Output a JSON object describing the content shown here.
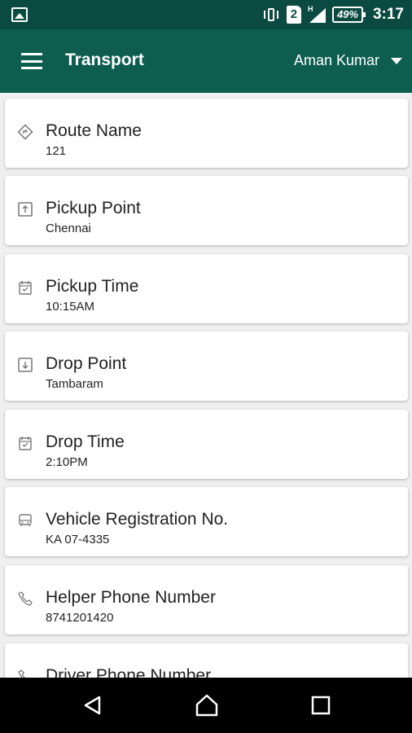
{
  "status_bar": {
    "sim": "2",
    "network": "H",
    "battery": "49%",
    "time": "3:17"
  },
  "app_bar": {
    "title": "Transport",
    "user": "Aman Kumar"
  },
  "items": [
    {
      "label": "Route Name",
      "value": "121",
      "icon": "route-sign-icon"
    },
    {
      "label": "Pickup Point",
      "value": "Chennai",
      "icon": "pickup-point-icon"
    },
    {
      "label": "Pickup Time",
      "value": "10:15AM",
      "icon": "calendar-icon"
    },
    {
      "label": "Drop Point",
      "value": "Tambaram",
      "icon": "drop-point-icon"
    },
    {
      "label": "Drop Time",
      "value": "2:10PM",
      "icon": "calendar-icon"
    },
    {
      "label": "Vehicle Registration No.",
      "value": "KA 07-4335",
      "icon": "bus-icon"
    },
    {
      "label": "Helper Phone Number",
      "value": "8741201420",
      "icon": "phone-icon"
    },
    {
      "label": "Driver Phone Number",
      "value": "",
      "icon": "phone-icon"
    }
  ],
  "colors": {
    "status_bar": "#0b4a40",
    "app_bar": "#0e5e50",
    "background": "#efefef"
  }
}
